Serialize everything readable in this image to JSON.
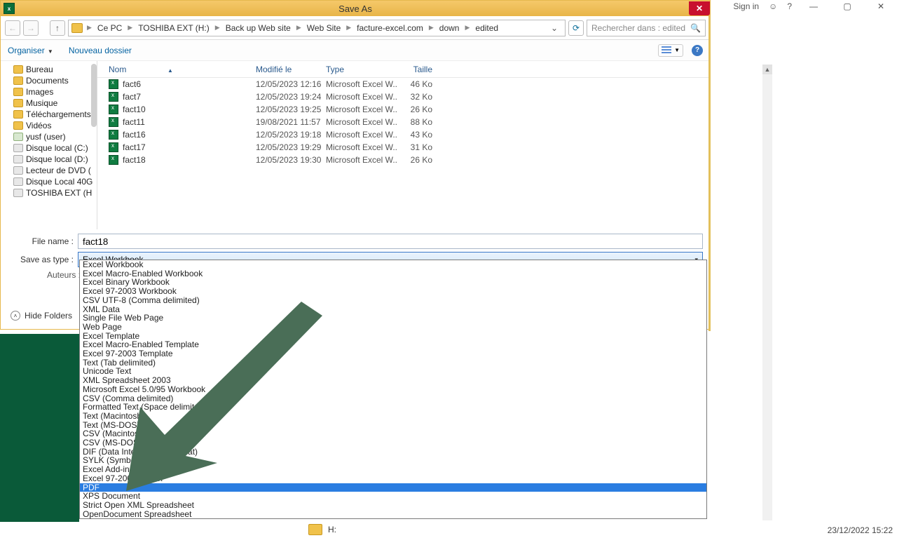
{
  "window": {
    "title": "Save As"
  },
  "excel_top": {
    "signin": "Sign in"
  },
  "breadcrumb": {
    "items": [
      "Ce PC",
      "TOSHIBA EXT (H:)",
      "Back up Web site",
      "Web Site",
      "facture-excel.com",
      "down",
      "edited"
    ]
  },
  "search": {
    "placeholder": "Rechercher dans : edited"
  },
  "toolbar": {
    "organize": "Organiser",
    "new_folder": "Nouveau dossier"
  },
  "columns": {
    "name": "Nom",
    "modified": "Modifié le",
    "type": "Type",
    "size": "Taille"
  },
  "tree": {
    "items": [
      "Bureau",
      "Documents",
      "Images",
      "Musique",
      "Téléchargements",
      "Vidéos",
      "yusf (user)",
      "Disque local (C:)",
      "Disque local (D:)",
      "Lecteur de DVD (",
      "Disque Local 40G",
      "TOSHIBA EXT (H"
    ]
  },
  "files": [
    {
      "name": "fact6",
      "mod": "12/05/2023 12:16",
      "type": "Microsoft Excel W...",
      "size": "46 Ko"
    },
    {
      "name": "fact7",
      "mod": "12/05/2023 19:24",
      "type": "Microsoft Excel W...",
      "size": "32 Ko"
    },
    {
      "name": "fact10",
      "mod": "12/05/2023 19:25",
      "type": "Microsoft Excel W...",
      "size": "26 Ko"
    },
    {
      "name": "fact11",
      "mod": "19/08/2021 11:57",
      "type": "Microsoft Excel W...",
      "size": "88 Ko"
    },
    {
      "name": "fact16",
      "mod": "12/05/2023 19:18",
      "type": "Microsoft Excel W...",
      "size": "43 Ko"
    },
    {
      "name": "fact17",
      "mod": "12/05/2023 19:29",
      "type": "Microsoft Excel W...",
      "size": "31 Ko"
    },
    {
      "name": "fact18",
      "mod": "12/05/2023 19:30",
      "type": "Microsoft Excel W...",
      "size": "26 Ko"
    }
  ],
  "fields": {
    "file_name_label": "File name :",
    "file_name_value": "fact18",
    "save_type_label": "Save as type :",
    "save_type_value": "Excel Workbook",
    "authors_label": "Auteurs :"
  },
  "hide_folders_label": "Hide Folders",
  "filetypes": [
    "Excel Workbook",
    "Excel Macro-Enabled Workbook",
    "Excel Binary Workbook",
    "Excel 97-2003 Workbook",
    "CSV UTF-8 (Comma delimited)",
    "XML Data",
    "Single File Web Page",
    "Web Page",
    "Excel Template",
    "Excel Macro-Enabled Template",
    "Excel 97-2003 Template",
    "Text (Tab delimited)",
    "Unicode Text",
    "XML Spreadsheet 2003",
    "Microsoft Excel 5.0/95 Workbook",
    "CSV (Comma delimited)",
    "Formatted Text (Space delimited)",
    "Text (Macintosh)",
    "Text (MS-DOS)",
    "CSV (Macintosh)",
    "CSV (MS-DOS)",
    "DIF (Data Interchange Format)",
    "SYLK (Symbolic Link)",
    "Excel Add-in",
    "Excel 97-2003 Add-in",
    "PDF",
    "XPS Document",
    "Strict Open XML Spreadsheet",
    "OpenDocument Spreadsheet"
  ],
  "highlighted_type_index": 25,
  "taskbar": {
    "drive": "H:",
    "clock": "23/12/2022 15:22"
  }
}
